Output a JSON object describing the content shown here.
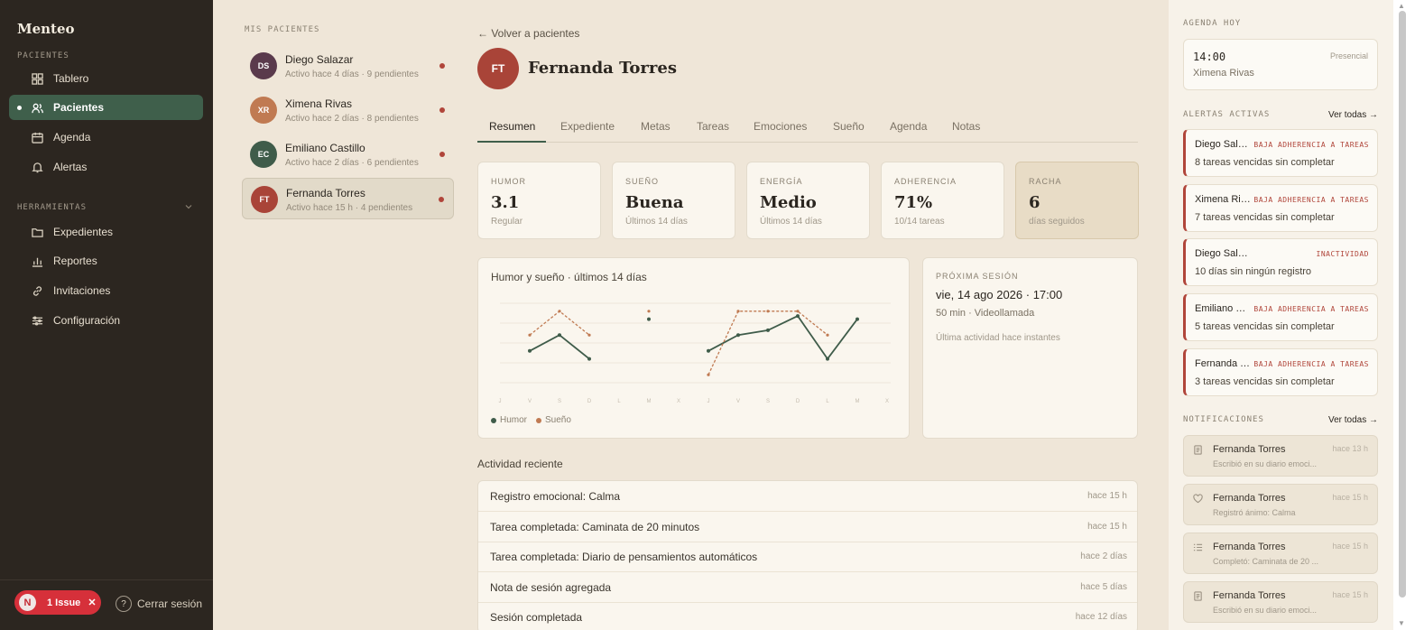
{
  "app": {
    "brand": "Menteo"
  },
  "sidebar": {
    "section_patients": "PACIENTES",
    "section_tools": "HERRAMIENTAS",
    "items": [
      {
        "label": "Tablero",
        "icon": "dashboard-icon"
      },
      {
        "label": "Pacientes",
        "icon": "users-icon"
      },
      {
        "label": "Agenda",
        "icon": "calendar-icon"
      },
      {
        "label": "Alertas",
        "icon": "bell-icon"
      }
    ],
    "tools": [
      {
        "label": "Expedientes",
        "icon": "folder-icon"
      },
      {
        "label": "Reportes",
        "icon": "bar-chart-icon"
      },
      {
        "label": "Invitaciones",
        "icon": "link-icon"
      },
      {
        "label": "Configuración",
        "icon": "sliders-icon"
      }
    ],
    "issue": {
      "badge": "N",
      "label": "1 Issue"
    },
    "logout": "Cerrar sesión"
  },
  "patients": {
    "title": "MIS PACIENTES",
    "list": [
      {
        "initials": "DS",
        "name": "Diego Salazar",
        "sub": "Activo hace 4 días · 9 pendientes",
        "color": "#5a3a4c"
      },
      {
        "initials": "XR",
        "name": "Ximena Rivas",
        "sub": "Activo hace 2 días · 8 pendientes",
        "color": "#c07a52"
      },
      {
        "initials": "EC",
        "name": "Emiliano Castillo",
        "sub": "Activo hace 2 días · 6 pendientes",
        "color": "#3f5c4a"
      },
      {
        "initials": "FT",
        "name": "Fernanda Torres",
        "sub": "Activo hace 15 h · 4 pendientes",
        "color": "#a94438"
      }
    ]
  },
  "main": {
    "back": "← Volver a pacientes",
    "initials": "FT",
    "name": "Fernanda Torres",
    "tabs": [
      "Resumen",
      "Expediente",
      "Metas",
      "Tareas",
      "Emociones",
      "Sueño",
      "Agenda",
      "Notas"
    ],
    "stats": [
      {
        "label": "HUMOR",
        "value": "3.1",
        "sub": "Regular"
      },
      {
        "label": "SUEÑO",
        "value": "Buena",
        "sub": "Últimos 14 días"
      },
      {
        "label": "ENERGÍA",
        "value": "Medio",
        "sub": "Últimos 14 días"
      },
      {
        "label": "ADHERENCIA",
        "value": "71%",
        "sub": "10/14 tareas"
      },
      {
        "label": "RACHA",
        "value": "6",
        "sub": "días seguidos"
      }
    ],
    "chart_title": "Humor y sueño · últimos 14 días",
    "next_session": {
      "label": "PRÓXIMA SESIÓN",
      "date": "vie, 14 ago 2026 · 17:00",
      "mode": "50 min · Videollamada",
      "activity": "Última actividad hace instantes"
    },
    "activity_title": "Actividad reciente",
    "activity": [
      {
        "text": "Registro emocional: Calma",
        "when": "hace 15 h"
      },
      {
        "text": "Tarea completada: Caminata de 20 minutos",
        "when": "hace 15 h"
      },
      {
        "text": "Tarea completada: Diario de pensamientos automáticos",
        "when": "hace 2 días"
      },
      {
        "text": "Nota de sesión agregada",
        "when": "hace 5 días"
      },
      {
        "text": "Sesión completada",
        "when": "hace 12 días"
      }
    ]
  },
  "chart_data": {
    "type": "line",
    "categories": [
      "J",
      "V",
      "S",
      "D",
      "L",
      "M",
      "X",
      "J",
      "V",
      "S",
      "D",
      "L",
      "M",
      "X"
    ],
    "series": [
      {
        "name": "Humor",
        "color": "#3f5c4a",
        "values": [
          null,
          2,
          3,
          1.5,
          null,
          4,
          null,
          2,
          3,
          3.3,
          4.2,
          1.5,
          4,
          null
        ]
      },
      {
        "name": "Sueño",
        "color": "#c07a52",
        "values": [
          null,
          3,
          4.5,
          3,
          null,
          4.5,
          null,
          0.5,
          4.5,
          4.5,
          4.5,
          3,
          null,
          null
        ]
      }
    ],
    "ylim": [
      0,
      5
    ],
    "legend": "bottom-left",
    "grid": true
  },
  "right": {
    "agenda_label": "AGENDA HOY",
    "agenda": {
      "time": "14:00",
      "mode": "Presencial",
      "who": "Ximena Rivas"
    },
    "alerts_label": "ALERTAS ACTIVAS",
    "see_all": "Ver todas →",
    "alerts": [
      {
        "name": "Diego Salazar",
        "tag": "BAJA ADHERENCIA A TAREAS",
        "desc": "8 tareas vencidas sin completar"
      },
      {
        "name": "Ximena Rivas",
        "tag": "BAJA ADHERENCIA A TAREAS",
        "desc": "7 tareas vencidas sin completar"
      },
      {
        "name": "Diego Salazar",
        "tag": "INACTIVIDAD",
        "desc": "10 días sin ningún registro"
      },
      {
        "name": "Emiliano Castillo",
        "tag": "BAJA ADHERENCIA A TAREAS",
        "desc": "5 tareas vencidas sin completar"
      },
      {
        "name": "Fernanda Torres",
        "tag": "BAJA ADHERENCIA A TAREAS",
        "desc": "3 tareas vencidas sin completar"
      }
    ],
    "notif_label": "NOTIFICACIONES",
    "notifs": [
      {
        "name": "Fernanda Torres",
        "when": "hace 13 h",
        "desc": "Escribió en su diario emoci...",
        "icon": "journal-icon"
      },
      {
        "name": "Fernanda Torres",
        "when": "hace 15 h",
        "desc": "Registró ánimo: Calma",
        "icon": "heart-icon"
      },
      {
        "name": "Fernanda Torres",
        "when": "hace 15 h",
        "desc": "Completó: Caminata de 20 ...",
        "icon": "checklist-icon"
      },
      {
        "name": "Fernanda Torres",
        "when": "hace 15 h",
        "desc": "Escribió en su diario emoci...",
        "icon": "journal-icon"
      }
    ]
  }
}
